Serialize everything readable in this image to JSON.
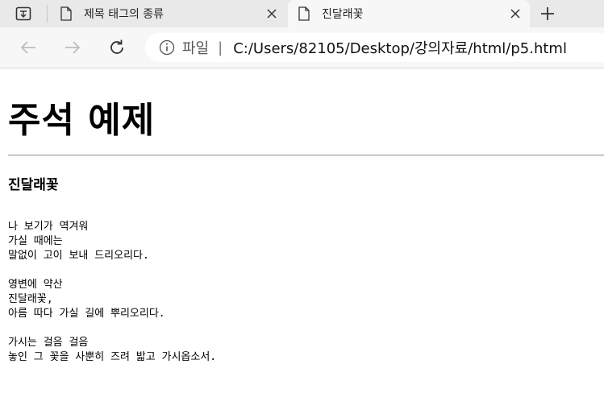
{
  "browser": {
    "tabs": [
      {
        "title": "제목 태그의 종류",
        "active": false
      },
      {
        "title": "진달래꽃",
        "active": true
      }
    ],
    "address_bar": {
      "scheme_label": "파일",
      "divider": "|",
      "url": "C:/Users/82105/Desktop/강의자료/html/p5.html"
    },
    "icons": {
      "tab_actions": "tab-actions-icon",
      "document": "document-icon",
      "close": "close-icon",
      "new_tab": "plus-icon",
      "back": "back-arrow-icon",
      "forward": "forward-arrow-icon",
      "refresh": "refresh-icon",
      "info": "info-icon"
    }
  },
  "content": {
    "heading": "주석 예제",
    "poem_title": "진달래꽃",
    "poem_text": "나 보기가 역겨워\n가실 때에는\n말없이 고이 보내 드리오리다.\n\n영변에 약산\n진달래꽃,\n아름 따다 가실 길에 뿌리오리다.\n\n가시는 걸음 걸음\n놓인 그 꽃을 사뿐히 즈려 밟고 가시옵소서."
  }
}
